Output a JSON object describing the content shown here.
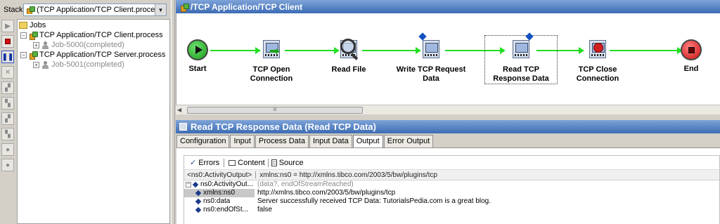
{
  "left_pane": {
    "stack_label": "Stack:",
    "stack_value": "(TCP Application/TCP Client.proce..."
  },
  "tree": {
    "root": "Jobs",
    "items": [
      {
        "label": "TCP Application/TCP Client.process",
        "job": "Job-5000(completed)"
      },
      {
        "label": "TCP Application/TCP Server.process",
        "job": "Job-5001(completed)"
      }
    ]
  },
  "process": {
    "title": "/TCP Application/TCP Client",
    "nodes": [
      {
        "label": "Start",
        "icon": "start-circle"
      },
      {
        "label": "TCP Open Connection",
        "icon": "tcp-open-activity"
      },
      {
        "label": "Read File",
        "icon": "read-file-magnifier"
      },
      {
        "label": "Write TCP Request Data",
        "icon": "tcp-write-activity"
      },
      {
        "label": "Read TCP Response Data",
        "icon": "tcp-read-activity"
      },
      {
        "label": "TCP Close Connection",
        "icon": "tcp-close-activity"
      },
      {
        "label": "End",
        "icon": "end-circle"
      }
    ],
    "scroll_thumb": "III"
  },
  "properties": {
    "title": "Read TCP Response Data (Read TCP Data)",
    "tabs": [
      "Configuration",
      "Input",
      "Process Data",
      "Input Data",
      "Output",
      "Error Output"
    ],
    "active_tab": "Output",
    "toolbar": {
      "errors": "Errors",
      "content": "Content",
      "source": "Source"
    },
    "xml_header": {
      "left": "<ns0:ActivityOutput>",
      "right": "xmlns:ns0 = http://xmlns.tibco.com/2003/5/bw/plugins/tcp"
    },
    "rows": [
      {
        "key": "ns0:ActivityOut...",
        "value": "(data?, endOfStreamReached)"
      },
      {
        "key": "xmlns:ns0",
        "value": "http://xmlns.tibco.com/2003/5/bw/plugins/tcp"
      },
      {
        "key": "ns0:data",
        "value": "Server successfully received TCP Data: TutorialsPedia.com is a great blog."
      },
      {
        "key": "ns0:endOfSt...",
        "value": "false"
      }
    ]
  },
  "colors": {
    "title_bar": "#3c6cb4",
    "transition": "#22dd22",
    "start": "#1a9a1a",
    "end": "#cc1010"
  }
}
